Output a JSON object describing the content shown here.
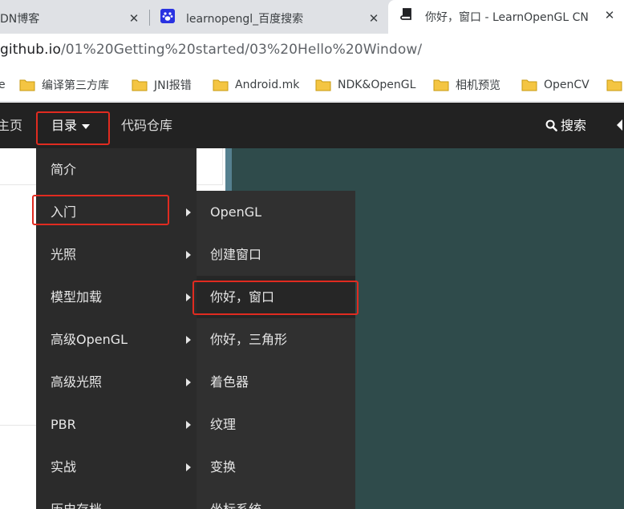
{
  "tabs": [
    {
      "title": "DN博客",
      "close": "✕"
    },
    {
      "title": "learnopengl_百度搜索",
      "close": "✕"
    },
    {
      "title": "你好，窗口 - LearnOpenGL CN",
      "close": "✕"
    }
  ],
  "address": {
    "host": "github.io",
    "path": "/01%20Getting%20started/03%20Hello%20Window/"
  },
  "bookmarks": [
    {
      "label": "e"
    },
    {
      "label": "编译第三方库"
    },
    {
      "label": "JNI报错"
    },
    {
      "label": "Android.mk"
    },
    {
      "label": "NDK&OpenGL"
    },
    {
      "label": "相机预览"
    },
    {
      "label": "OpenCV"
    }
  ],
  "navbar": {
    "home": "主页",
    "catalog": "目录",
    "repo": "代码仓库",
    "search": "搜索"
  },
  "menu_level1": [
    {
      "label": "简介",
      "has_sub": false
    },
    {
      "label": "入门",
      "has_sub": true
    },
    {
      "label": "光照",
      "has_sub": true
    },
    {
      "label": "模型加载",
      "has_sub": true
    },
    {
      "label": "高级OpenGL",
      "has_sub": true
    },
    {
      "label": "高级光照",
      "has_sub": true
    },
    {
      "label": "PBR",
      "has_sub": true
    },
    {
      "label": "实战",
      "has_sub": true
    },
    {
      "label": "历史存档",
      "has_sub": false
    }
  ],
  "menu_level2": [
    {
      "label": "OpenGL"
    },
    {
      "label": "创建窗口"
    },
    {
      "label": "你好，窗口"
    },
    {
      "label": "你好，三角形"
    },
    {
      "label": "着色器"
    },
    {
      "label": "纹理"
    },
    {
      "label": "变换"
    },
    {
      "label": "坐标系统"
    }
  ],
  "colors": {
    "highlight": "#e02b20",
    "navbar_bg": "#222222",
    "menu_bg": "#2b2b2b",
    "content_bg": "#2f4b4b"
  }
}
